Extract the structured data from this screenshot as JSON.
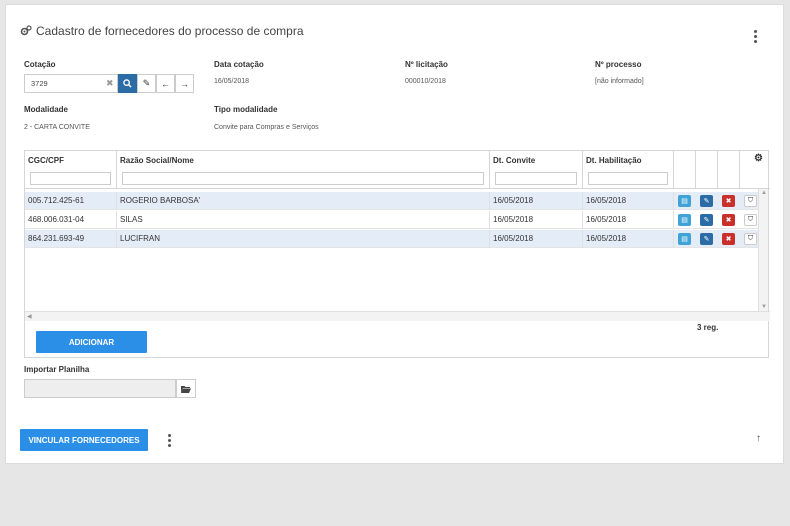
{
  "page": {
    "title": "Cadastro de fornecedores do processo de compra"
  },
  "fields": {
    "cotacao_label": "Cotação",
    "cotacao_value": "3729",
    "data_cotacao_label": "Data cotação",
    "data_cotacao_value": "16/05/2018",
    "licitacao_label": "Nº licitação",
    "licitacao_value": "000010/2018",
    "processo_label": "Nº processo",
    "processo_value": "[não informado]",
    "modalidade_label": "Modalidade",
    "modalidade_value": "2 - CARTA CONVITE",
    "tipo_modalidade_label": "Tipo modalidade",
    "tipo_modalidade_value": "Convite para Compras e Serviços"
  },
  "grid": {
    "columns": [
      "CGC/CPF",
      "Razão Social/Nome",
      "Dt. Convite",
      "Dt. Habilitação"
    ],
    "rows": [
      {
        "cpf": "005.712.425-61",
        "nome": "ROGERIO BARBOSA'",
        "convite": "16/05/2018",
        "habilitacao": "16/05/2018"
      },
      {
        "cpf": "468.006.031-04",
        "nome": "SILAS",
        "convite": "16/05/2018",
        "habilitacao": "16/05/2018"
      },
      {
        "cpf": "864.231.693-49",
        "nome": "LUCIFRAN",
        "convite": "16/05/2018",
        "habilitacao": "16/05/2018"
      }
    ],
    "add_button": "ADICIONAR",
    "record_count": "3 reg."
  },
  "import": {
    "label": "Importar Planilha"
  },
  "footer": {
    "link_button": "VINCULAR FORNECEDORES"
  },
  "colors": {
    "primary": "#2b6ca6",
    "accent": "#2b8fe8",
    "danger": "#c9302c",
    "info": "#3fa3d8",
    "row_alt": "#e4edf7"
  }
}
